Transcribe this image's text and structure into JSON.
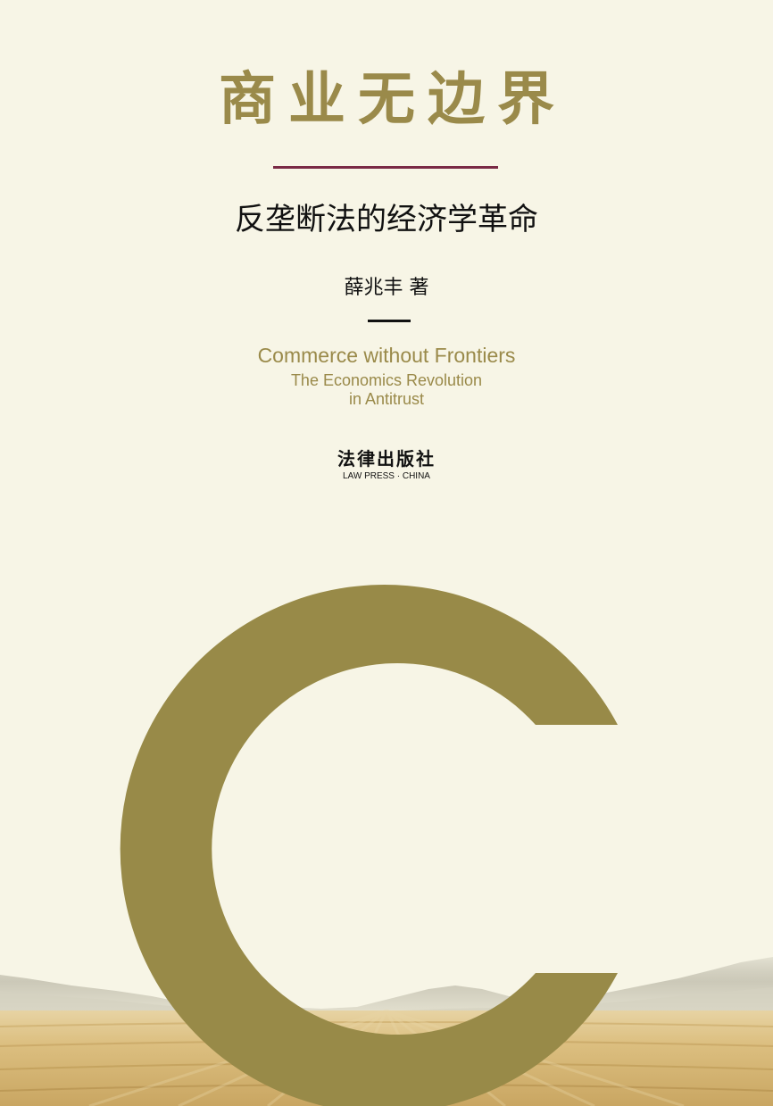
{
  "cover": {
    "title_cn": "商业无边界",
    "subtitle_cn": "反垄断法的经济学革命",
    "author": "薛兆丰 著",
    "title_en": "Commerce without Frontiers",
    "subtitle_en_line1": "The Economics Revolution",
    "subtitle_en_line2": "in Antitrust",
    "publisher_cn": "法律出版社",
    "publisher_en": "LAW PRESS · CHINA"
  },
  "colors": {
    "background": "#f7f5e6",
    "olive": "#988a48",
    "accent_rule": "#7a2a45",
    "text_dark": "#111111",
    "field": "#d6b777"
  },
  "icons": {
    "cover_graphic": "letter-c-ring",
    "scenery": "mountains-and-wheat-field"
  }
}
